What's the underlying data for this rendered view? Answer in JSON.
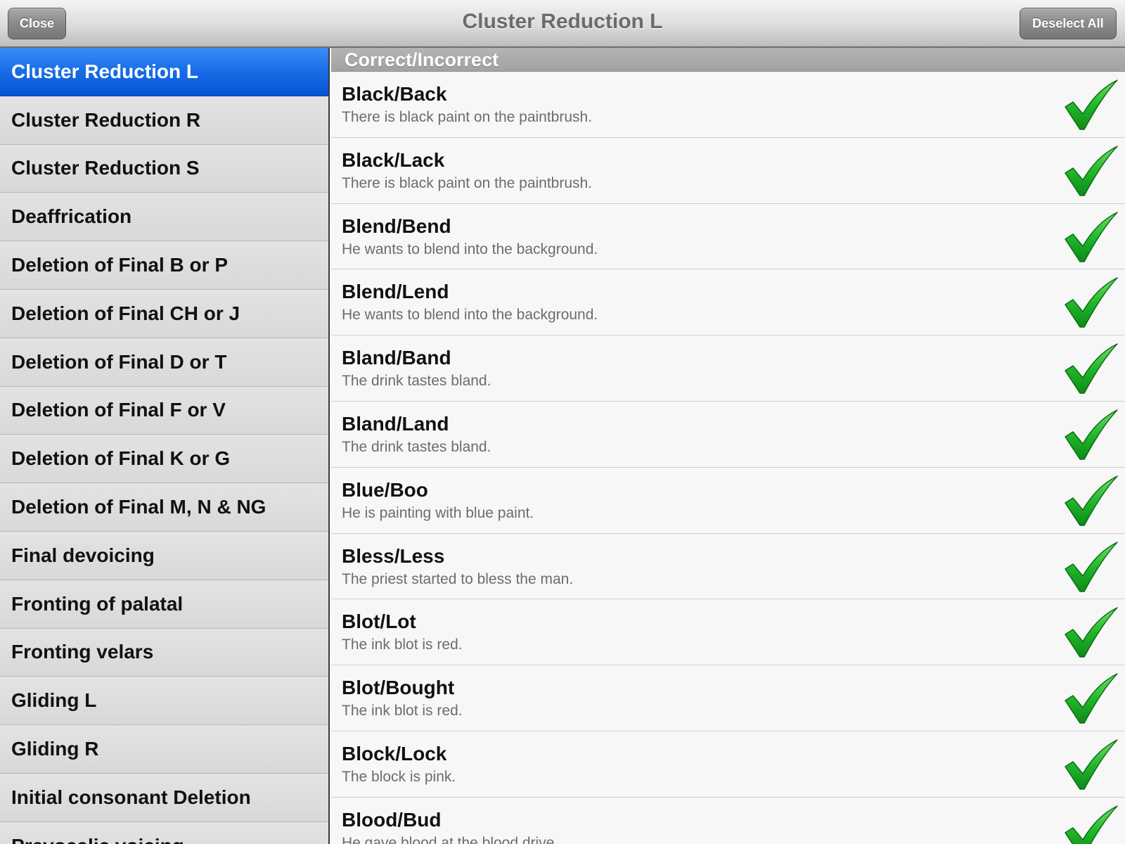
{
  "navbar": {
    "title": "Cluster Reduction L",
    "close_label": "Close",
    "deselect_label": "Deselect All"
  },
  "sidebar": {
    "selected_index": 0,
    "items": [
      {
        "label": "Cluster Reduction L"
      },
      {
        "label": "Cluster Reduction R"
      },
      {
        "label": "Cluster Reduction S"
      },
      {
        "label": "Deaffrication"
      },
      {
        "label": "Deletion of Final B or P"
      },
      {
        "label": "Deletion of Final CH or J"
      },
      {
        "label": "Deletion of Final D or T"
      },
      {
        "label": "Deletion of Final F or V"
      },
      {
        "label": "Deletion of Final K or G"
      },
      {
        "label": "Deletion of Final M, N & NG"
      },
      {
        "label": "Final devoicing"
      },
      {
        "label": "Fronting of palatal"
      },
      {
        "label": "Fronting velars"
      },
      {
        "label": "Gliding L"
      },
      {
        "label": "Gliding R"
      },
      {
        "label": "Initial consonant Deletion"
      },
      {
        "label": "Prevocalic voicing"
      }
    ]
  },
  "content": {
    "section_header": "Correct/Incorrect",
    "rows": [
      {
        "title": "Black/Back",
        "subtitle": "There is black paint on the paintbrush.",
        "checked": true
      },
      {
        "title": "Black/Lack",
        "subtitle": "There is black paint on the paintbrush.",
        "checked": true
      },
      {
        "title": "Blend/Bend",
        "subtitle": "He wants to blend into the background.",
        "checked": true
      },
      {
        "title": "Blend/Lend",
        "subtitle": "He wants to blend into the background.",
        "checked": true
      },
      {
        "title": "Bland/Band",
        "subtitle": "The drink tastes bland.",
        "checked": true
      },
      {
        "title": "Bland/Land",
        "subtitle": "The drink tastes bland.",
        "checked": true
      },
      {
        "title": "Blue/Boo",
        "subtitle": "He is painting with blue paint.",
        "checked": true
      },
      {
        "title": "Bless/Less",
        "subtitle": "The priest started to bless the man.",
        "checked": true
      },
      {
        "title": "Blot/Lot",
        "subtitle": "The ink blot is red.",
        "checked": true
      },
      {
        "title": "Blot/Bought",
        "subtitle": "The ink blot is red.",
        "checked": true
      },
      {
        "title": "Block/Lock",
        "subtitle": "The block is pink.",
        "checked": true
      },
      {
        "title": "Blood/Bud",
        "subtitle": "He gave blood at the blood drive.",
        "checked": true
      }
    ]
  },
  "colors": {
    "selected_blue": "#1a6fe8",
    "check_green": "#1fb52a"
  },
  "icons": {
    "checkmark": "check-icon"
  }
}
